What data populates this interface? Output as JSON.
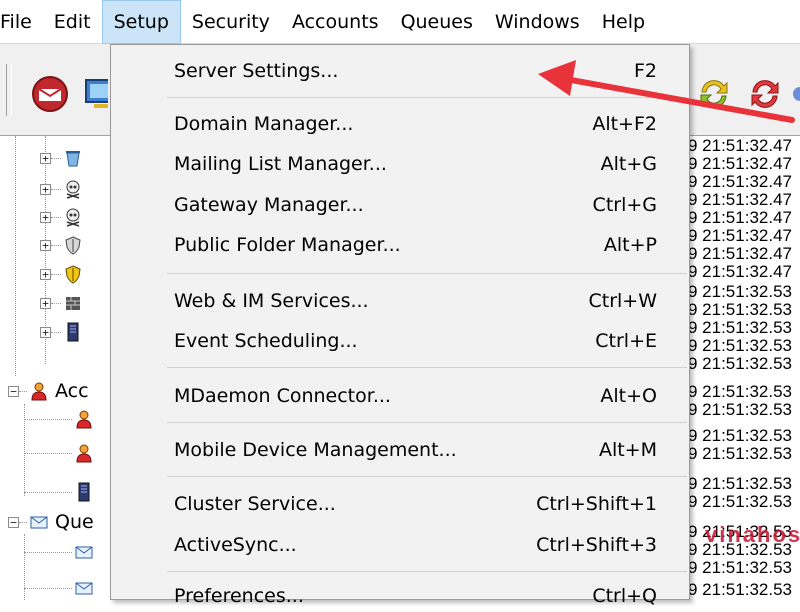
{
  "menubar": {
    "items": [
      "File",
      "Edit",
      "Setup",
      "Security",
      "Accounts",
      "Queues",
      "Windows",
      "Help"
    ],
    "active": "Setup"
  },
  "toolbar": {
    "buttons": [
      "mail-icon",
      "computer-icon",
      "refresh-yellow-icon",
      "refresh-red-icon"
    ]
  },
  "tree": {
    "items": [
      {
        "icon": "trash-icon"
      },
      {
        "icon": "skull-icon"
      },
      {
        "icon": "skull-icon"
      },
      {
        "icon": "shield-icon"
      },
      {
        "icon": "shield-yellow-icon"
      },
      {
        "icon": "firewall-icon"
      },
      {
        "icon": "server-icon"
      },
      {
        "icon": "user-icon",
        "label": "Acc"
      },
      {
        "icon": "user-icon"
      },
      {
        "icon": "user-icon"
      },
      {
        "icon": "server-icon"
      },
      {
        "icon": "envelope-icon",
        "label": "Que"
      },
      {
        "icon": "envelope-icon"
      },
      {
        "icon": "envelope-icon"
      }
    ]
  },
  "log": {
    "lines": [
      "9 21:51:32.47",
      "9 21:51:32.47",
      "9 21:51:32.47",
      "9 21:51:32.47",
      "9 21:51:32.47",
      "9 21:51:32.47",
      "9 21:51:32.47",
      "9 21:51:32.47",
      "9 21:51:32.53",
      "9 21:51:32.53",
      "9 21:51:32.53",
      "9 21:51:32.53",
      "9 21:51:32.53",
      "9 21:51:32.53",
      "9 21:51:32.53",
      "9 21:51:32.53",
      "9 21:51:32.53",
      "9 21:51:32.53",
      "9 21:51:32.53",
      "9 21:51:32.53",
      "9 21:51:32.53",
      "9 21:51:32.53",
      "9 21:51:32.53"
    ]
  },
  "setup_menu": {
    "server_settings": {
      "label": "Server Settings...",
      "shortcut": "F2"
    },
    "domain_manager": {
      "label": "Domain Manager...",
      "shortcut": "Alt+F2"
    },
    "mailing_list_manager": {
      "label": "Mailing List Manager...",
      "shortcut": "Alt+G"
    },
    "gateway_manager": {
      "label": "Gateway Manager...",
      "shortcut": "Ctrl+G"
    },
    "public_folder_manager": {
      "label": "Public Folder Manager...",
      "shortcut": "Alt+P"
    },
    "web_im_services": {
      "label": "Web & IM Services...",
      "shortcut": "Ctrl+W"
    },
    "event_scheduling": {
      "label": "Event Scheduling...",
      "shortcut": "Ctrl+E"
    },
    "mdaemon_connector": {
      "label": "MDaemon Connector...",
      "shortcut": "Alt+O"
    },
    "mobile_device_management": {
      "label": "Mobile Device Management...",
      "shortcut": "Alt+M"
    },
    "cluster_service": {
      "label": "Cluster Service...",
      "shortcut": "Ctrl+Shift+1"
    },
    "activesync": {
      "label": "ActiveSync...",
      "shortcut": "Ctrl+Shift+3"
    },
    "preferences": {
      "label": "Preferences...",
      "shortcut": "Ctrl+Q"
    }
  },
  "watermark": "vinahost",
  "colors": {
    "menu_highlight": "#cce4f7",
    "menu_background": "#f2f2f2",
    "arrow": "#e8333b",
    "watermark": "#c8102e"
  }
}
